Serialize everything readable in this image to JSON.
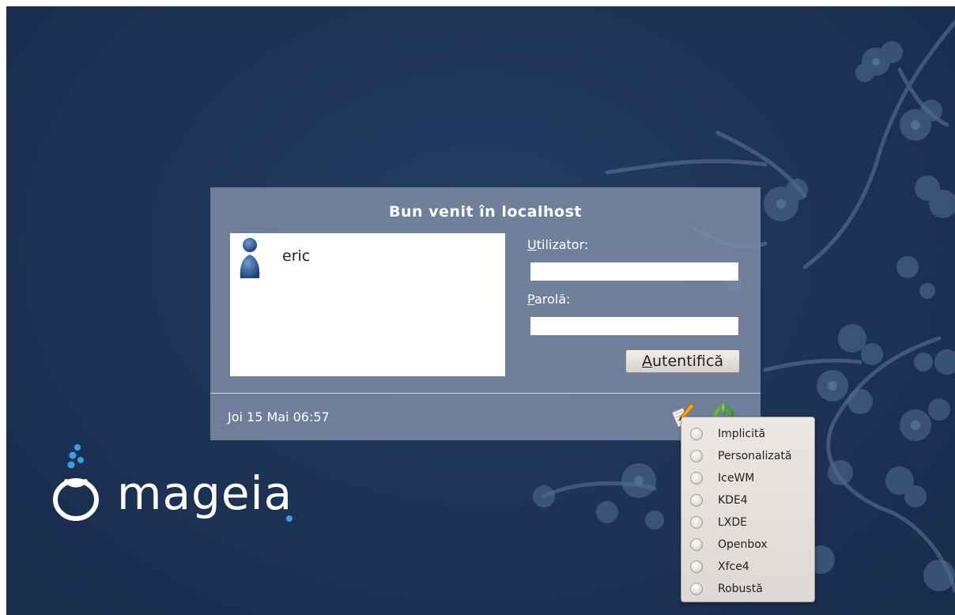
{
  "login": {
    "title": "Bun venit în localhost",
    "user_name": "eric",
    "username_label_accel": "U",
    "username_label_rest": "tilizator:",
    "username_value": "",
    "password_label_accel": "P",
    "password_label_rest": "arolă:",
    "password_value": "",
    "button_accel": "A",
    "button_rest": "utentifică",
    "datetime": "Joi 15 Mai 06:57"
  },
  "session_menu": {
    "items": [
      {
        "label": "Implicită"
      },
      {
        "label": "Personalizată"
      },
      {
        "label": "IceWM"
      },
      {
        "label": "KDE4"
      },
      {
        "label": "LXDE"
      },
      {
        "label": "Openbox"
      },
      {
        "label": "Xfce4"
      },
      {
        "label": "Robustă"
      }
    ]
  },
  "logo": {
    "text": "mageia"
  },
  "icons": {
    "session": "session-edit-icon",
    "power": "power-icon",
    "user": "user-avatar-icon"
  },
  "colors": {
    "background": "#1d3355",
    "panel": "#7d8ca5",
    "logo_accent": "#3aa0e0"
  }
}
